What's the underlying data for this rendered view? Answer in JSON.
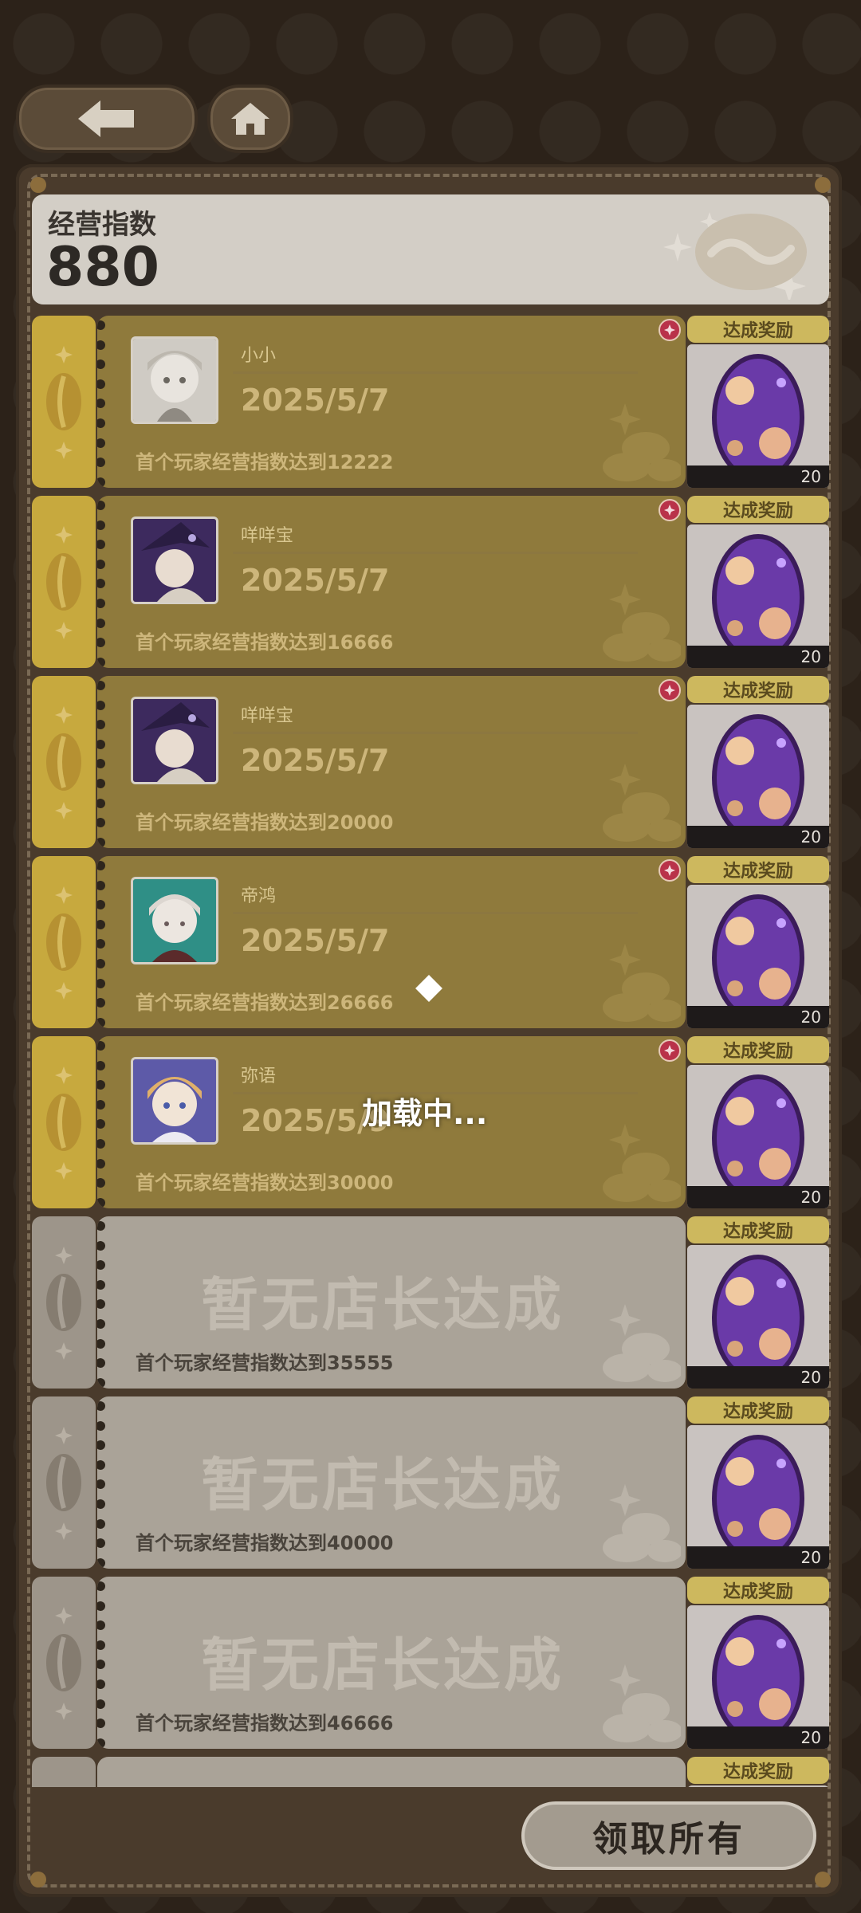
{
  "header": {
    "score_title": "经营指数",
    "score_value": "880"
  },
  "entries": [
    {
      "status": "achieved",
      "player": "小小",
      "date": "2025/5/7",
      "condition": "首个玩家经营指数达到12222",
      "reward_label": "达成奖励",
      "reward_count": "20",
      "avatar": "avatar-silver-hair"
    },
    {
      "status": "achieved",
      "player": "咩咩宝",
      "date": "2025/5/7",
      "condition": "首个玩家经营指数达到16666",
      "reward_label": "达成奖励",
      "reward_count": "20",
      "avatar": "avatar-witch"
    },
    {
      "status": "achieved",
      "player": "咩咩宝",
      "date": "2025/5/7",
      "condition": "首个玩家经营指数达到20000",
      "reward_label": "达成奖励",
      "reward_count": "20",
      "avatar": "avatar-witch"
    },
    {
      "status": "achieved",
      "player": "帝鸿",
      "date": "2025/5/7",
      "condition": "首个玩家经营指数达到26666",
      "reward_label": "达成奖励",
      "reward_count": "20",
      "avatar": "avatar-teal"
    },
    {
      "status": "achieved",
      "player": "弥语",
      "date": "2025/5/9",
      "condition": "首个玩家经营指数达到30000",
      "reward_label": "达成奖励",
      "reward_count": "20",
      "avatar": "avatar-blonde"
    },
    {
      "status": "empty",
      "empty_text": "暂无店长达成",
      "condition": "首个玩家经营指数达到35555",
      "reward_label": "达成奖励",
      "reward_count": "20"
    },
    {
      "status": "empty",
      "empty_text": "暂无店长达成",
      "condition": "首个玩家经营指数达到40000",
      "reward_label": "达成奖励",
      "reward_count": "20"
    },
    {
      "status": "empty",
      "empty_text": "暂无店长达成",
      "condition": "首个玩家经营指数达到46666",
      "reward_label": "达成奖励",
      "reward_count": "20"
    },
    {
      "status": "empty",
      "reward_label": "达成奖励"
    }
  ],
  "claim_all_label": "领取所有",
  "loading_text": "加载中..."
}
